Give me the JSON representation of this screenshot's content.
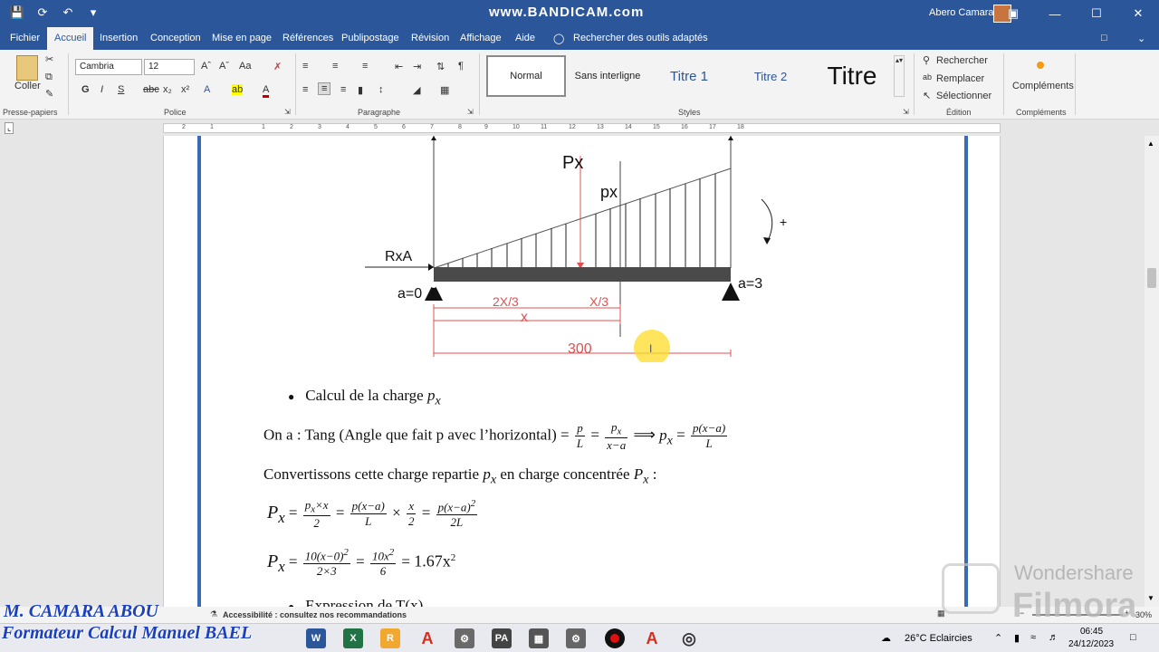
{
  "watermark": "www.BANDICAM.com",
  "user_name": "Abero Camara",
  "tabs": [
    "Fichier",
    "Accueil",
    "Insertion",
    "Conception",
    "Mise en page",
    "Références",
    "Publipostage",
    "Révision",
    "Affichage",
    "Aide"
  ],
  "search_tools": "Rechercher des outils adaptés",
  "ribbon": {
    "paste": "Coller",
    "font_name": "Cambria",
    "font_size": "12",
    "styles": [
      "Normal",
      "Sans interligne",
      "Titre 1",
      "Titre 2",
      "Titre"
    ],
    "find": "Rechercher",
    "replace": "Remplacer",
    "select": "Sélectionner",
    "addins": "Compléments",
    "groups": {
      "clipboard": "Presse-papiers",
      "font": "Police",
      "paragraph": "Paragraphe",
      "styles": "Styles",
      "editing": "Édition",
      "addins": "Compléments"
    }
  },
  "ruler_numbers": [
    "2",
    "1",
    "1",
    "2",
    "3",
    "4",
    "5",
    "6",
    "7",
    "8",
    "9",
    "10",
    "11",
    "12",
    "13",
    "14",
    "15",
    "16",
    "17",
    "18"
  ],
  "diagram": {
    "Px": "Px",
    "px": "px",
    "RxA": "RxA",
    "a0": "a=0",
    "a3": "a=3",
    "two_x_third": "2X/3",
    "x_third": "X/3",
    "x": "x",
    "length": "300",
    "plus": "+"
  },
  "doc": {
    "bullet1": "Calcul de la charge",
    "line1_prefix": "On a : Tang (Angle que fait p avec l’horizontal) =",
    "line2": "Convertissons cette charge repartie",
    "line2b": "en charge concentrée",
    "result": "1.67x",
    "bullet2": "Expression de T(x)"
  },
  "status": {
    "accessibility": "Accessibilité : consultez nos recommandations",
    "zoom": "30%"
  },
  "taskbar": {
    "weather": "26°C  Eclaircies",
    "time": "06:45",
    "date": "24/12/2023"
  },
  "overlay": {
    "line1": "M. CAMARA  ABOU",
    "line2": "Formateur Calcul Manuel BAEL"
  },
  "brand": {
    "wondershare": "Wondershare",
    "filmora": "Filmora"
  },
  "colors": {
    "accent": "#2b579a",
    "overlay_text": "#1a3fbf",
    "diagram_red": "#e05050"
  }
}
